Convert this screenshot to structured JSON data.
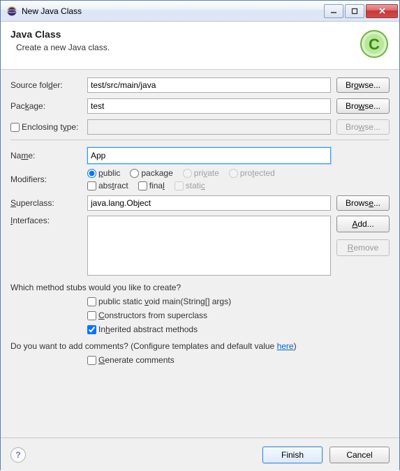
{
  "window": {
    "title": "New Java Class"
  },
  "banner": {
    "title": "Java Class",
    "description": "Create a new Java class."
  },
  "fields": {
    "sourceFolder": {
      "label": "Source folder:",
      "value": "test/src/main/java",
      "browse": "Browse..."
    },
    "package": {
      "label": "Package:",
      "value": "test",
      "browse": "Browse..."
    },
    "enclosingType": {
      "label": "Enclosing type:",
      "value": "",
      "browse": "Browse..."
    },
    "name": {
      "label": "Name:",
      "value": "App"
    },
    "modifiers": {
      "label": "Modifiers:",
      "access": {
        "public": "public",
        "package": "package",
        "private": "private",
        "protected": "protected"
      },
      "flags": {
        "abstract": "abstract",
        "final": "final",
        "static": "static"
      }
    },
    "superclass": {
      "label": "Superclass:",
      "value": "java.lang.Object",
      "browse": "Browse..."
    },
    "interfaces": {
      "label": "Interfaces:",
      "add": "Add...",
      "remove": "Remove"
    }
  },
  "stubs": {
    "question": "Which method stubs would you like to create?",
    "main": "public static void main(String[] args)",
    "constructors": "Constructors from superclass",
    "inherited": "Inherited abstract methods"
  },
  "comments": {
    "question_prefix": "Do you want to add comments? (Configure templates and default value ",
    "link": "here",
    "question_suffix": ")",
    "generate": "Generate comments"
  },
  "footer": {
    "finish": "Finish",
    "cancel": "Cancel"
  }
}
